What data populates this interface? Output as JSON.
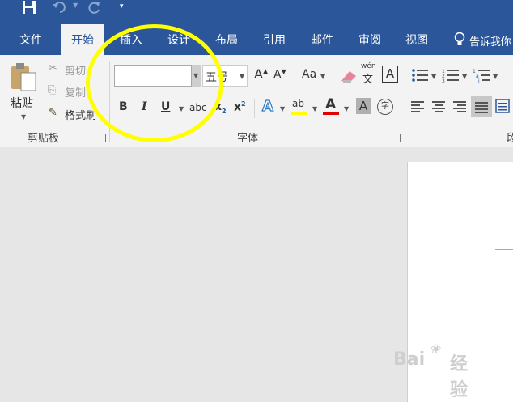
{
  "quick_access": {
    "save_icon": "save-icon",
    "undo_icon": "undo-icon",
    "redo_icon": "redo-icon",
    "customize_icon": "customize-icon"
  },
  "tabs": [
    {
      "label": "文件"
    },
    {
      "label": "开始"
    },
    {
      "label": "插入"
    },
    {
      "label": "设计"
    },
    {
      "label": "布局"
    },
    {
      "label": "引用"
    },
    {
      "label": "邮件"
    },
    {
      "label": "审阅"
    },
    {
      "label": "视图"
    }
  ],
  "tell_me": {
    "label": "告诉我你"
  },
  "clipboard": {
    "group_label": "剪贴板",
    "paste": "粘贴",
    "cut": "剪切",
    "copy": "复制",
    "format_painter": "格式刷"
  },
  "font": {
    "group_label": "字体",
    "font_name": "",
    "font_size": "五号",
    "change_case": "Aa",
    "phonetic_top": "wén",
    "phonetic_bottom": "文",
    "char_border": "A",
    "bold": "B",
    "italic": "I",
    "underline": "U",
    "strikethrough": "abc",
    "subscript": "x",
    "subscript_mark": "2",
    "superscript": "x",
    "superscript_mark": "2",
    "text_effects": "A",
    "highlight": "ab",
    "font_color": "A",
    "char_shading": "A",
    "enclose_char": "字"
  },
  "paragraph": {
    "group_label": "段"
  },
  "colors": {
    "brand": "#2b579a",
    "highlight": "#ffff00",
    "font_color": "#e00000",
    "annotation": "#ffff00"
  },
  "watermark": {
    "text": "Bai",
    "text2": "经验"
  }
}
